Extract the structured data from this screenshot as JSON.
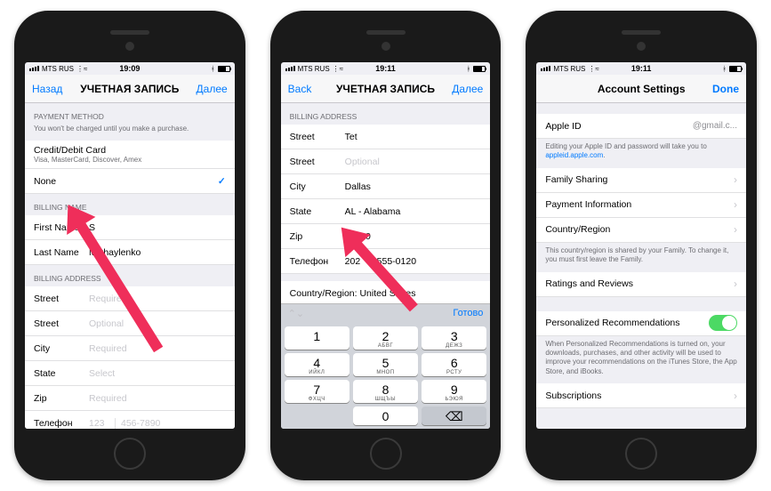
{
  "phone1": {
    "status": {
      "carrier": "MTS RUS",
      "time": "19:09"
    },
    "nav": {
      "back": "Назад",
      "title": "УЧЕТНАЯ ЗАПИСЬ",
      "next": "Далее"
    },
    "payment_header": "PAYMENT METHOD",
    "payment_footer": "You won't be charged until you make a purchase.",
    "card": {
      "title": "Credit/Debit Card",
      "sub": "Visa, MasterCard, Discover, Amex"
    },
    "none": "None",
    "billing_name_header": "BILLING NAME",
    "first_name_label": "First Name",
    "first_name_value": "S",
    "last_name_label": "Last Name",
    "last_name_value": "Mikhaylenko",
    "billing_addr_header": "BILLING ADDRESS",
    "street_label": "Street",
    "required": "Required",
    "optional": "Optional",
    "city_label": "City",
    "state_label": "State",
    "select": "Select",
    "zip_label": "Zip",
    "phone_label": "Телефон",
    "phone_code": "123",
    "phone_num": "456-7890"
  },
  "phone2": {
    "status": {
      "carrier": "MTS RUS",
      "time": "19:11"
    },
    "nav": {
      "back": "Back",
      "title": "УЧЕТНАЯ ЗАПИСЬ",
      "next": "Далее"
    },
    "billing_addr_header": "BILLING ADDRESS",
    "street_label": "Street",
    "street_value": "Tet",
    "optional": "Optional",
    "city_label": "City",
    "city_value": "Dallas",
    "state_label": "State",
    "state_value": "AL - Alabama",
    "zip_label": "Zip",
    "zip_value": "36310",
    "phone_label": "Телефон",
    "phone_code": "202",
    "phone_num": "555-0120",
    "country_label": "Country/Region: United States",
    "kb_done": "Готово",
    "keys": [
      {
        "d": "1",
        "l": ""
      },
      {
        "d": "2",
        "l": "АБВГ"
      },
      {
        "d": "3",
        "l": "ДЕЖЗ"
      },
      {
        "d": "4",
        "l": "ИЙКЛ"
      },
      {
        "d": "5",
        "l": "МНОП"
      },
      {
        "d": "6",
        "l": "РСТУ"
      },
      {
        "d": "7",
        "l": "ФХЦЧ"
      },
      {
        "d": "8",
        "l": "ШЩЪЫ"
      },
      {
        "d": "9",
        "l": "ЬЭЮЯ"
      },
      {
        "d": "",
        "l": ""
      },
      {
        "d": "0",
        "l": ""
      },
      {
        "d": "⌫",
        "l": ""
      }
    ]
  },
  "phone3": {
    "status": {
      "carrier": "MTS RUS",
      "time": "19:11"
    },
    "nav": {
      "title": "Account Settings",
      "done": "Done"
    },
    "apple_id_label": "Apple ID",
    "apple_id_value": "@gmail.c...",
    "apple_id_footer_text": "Editing your Apple ID and password will take you to ",
    "apple_id_footer_link": "appleid.apple.com",
    "family_sharing": "Family Sharing",
    "payment_info": "Payment Information",
    "country_region": "Country/Region",
    "country_footer": "This country/region is shared by your Family. To change it, you must first leave the Family.",
    "ratings": "Ratings and Reviews",
    "personalized": "Personalized Recommendations",
    "personalized_footer": "When Personalized Recommendations is turned on, your downloads, purchases, and other activity will be used to improve your recommendations on the iTunes Store, the App Store, and iBooks.",
    "subscriptions": "Subscriptions"
  }
}
